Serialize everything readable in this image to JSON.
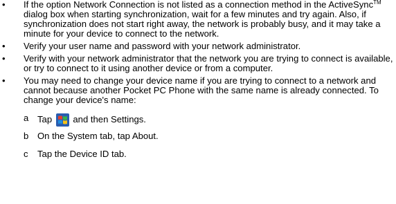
{
  "bullet_symbol": "•",
  "items": [
    {
      "pre": "If the option Network Connection is not listed as a connection method in the ActiveSync",
      "sup": "TM",
      "post": " dialog box when starting synchronization, wait for a few minutes and try again. Also, if synchronization does not start right away, the network is probably busy, and it may take a minute for your device to connect to the network."
    },
    {
      "text": "Verify your user name and password with your network administrator."
    },
    {
      "text": "Verify with your network administrator that the network you are trying to connect is available, or try to connect to it using another device or from a computer."
    },
    {
      "text": "You may need to change your device name if you are trying to connect to a network and cannot because another Pocket PC Phone with the same name is already connected. To change your device's name:"
    }
  ],
  "steps": [
    {
      "letter": "a",
      "pre": "Tap ",
      "icon": "windows-start-icon",
      "post": " and then Settings."
    },
    {
      "letter": "b",
      "text": "On the System tab, tap About."
    },
    {
      "letter": "c",
      "text": "Tap the Device ID tab."
    }
  ]
}
